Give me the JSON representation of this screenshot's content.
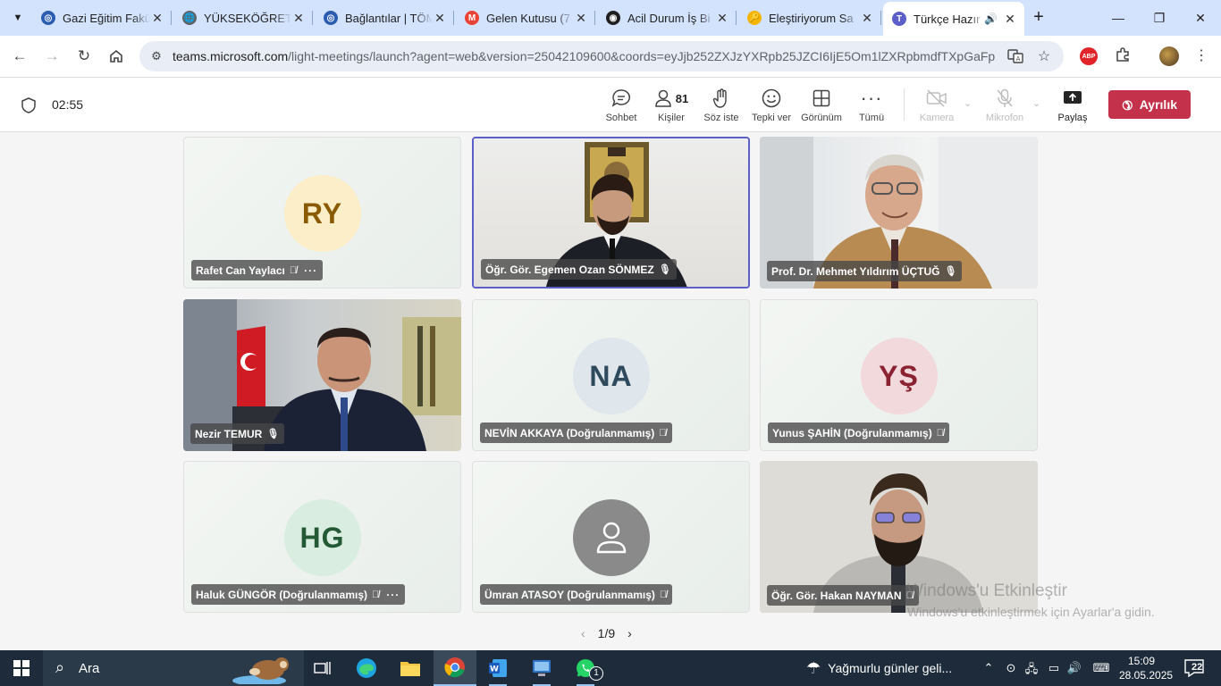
{
  "browser": {
    "tabs": [
      {
        "title": "Gazi Eğitim Fakü",
        "fav_color": "#2a5db0",
        "fav_glyph": "◎"
      },
      {
        "title": "YÜKSEKÖĞRETİM",
        "fav_color": "#5f6368",
        "fav_glyph": "🌐"
      },
      {
        "title": "Bağlantılar | TÖM",
        "fav_color": "#2a5db0",
        "fav_glyph": "◎"
      },
      {
        "title": "Gelen Kutusu (7",
        "fav_color": "#ea4335",
        "fav_glyph": "M"
      },
      {
        "title": "Acil Durum İş Bi",
        "fav_color": "#1f1f1f",
        "fav_glyph": "◉"
      },
      {
        "title": "Eleştiriyorum Sa",
        "fav_color": "#f4b400",
        "fav_glyph": "🔑"
      },
      {
        "title": "Türkçe Hazır",
        "fav_color": "#5b5fc7",
        "fav_glyph": "T"
      }
    ],
    "url_host": "teams.microsoft.com",
    "url_path": "/light-meetings/launch?agent=web&version=25042109600&coords=eyJjb252ZXJzYXRpb25JZCI6IjE5Om1lZXRpbmdfTXpGaFp...",
    "abp_label": "ABP"
  },
  "meeting": {
    "timer": "02:55",
    "controls": {
      "chat": "Sohbet",
      "people": "Kişiler",
      "people_count": "81",
      "raise_hand": "Söz iste",
      "react": "Tepki ver",
      "view": "Görünüm",
      "more": "Tümü",
      "camera": "Kamera",
      "mic": "Mikrofon",
      "share": "Paylaş",
      "leave": "Ayrılık"
    },
    "participants": [
      {
        "name": "Rafet Can Yaylacı",
        "initials": "RY",
        "avatar_bg": "#fbeec8",
        "avatar_fg": "#8a5a00",
        "has_more": true
      },
      {
        "name": "Öğr. Gör. Egemen Ozan SÖNMEZ",
        "video": "office"
      },
      {
        "name": "Prof. Dr. Mehmet Yıldırım ÜÇTUĞ",
        "video": "window"
      },
      {
        "name": "Nezir TEMUR",
        "video": "flag"
      },
      {
        "name": "NEVİN AKKAYA (Doğrulanmamış)",
        "initials": "NA",
        "avatar_bg": "#dfe6ec",
        "avatar_fg": "#2e4a5c"
      },
      {
        "name": "Yunus ŞAHİN (Doğrulanmamış)",
        "initials": "YŞ",
        "avatar_bg": "#f2d9dc",
        "avatar_fg": "#8a2232"
      },
      {
        "name": "Haluk GÜNGÖR (Doğrulanmamış)",
        "initials": "HG",
        "avatar_bg": "#d9ede0",
        "avatar_fg": "#235a35",
        "has_more": true
      },
      {
        "name": "Ümran ATASOY (Doğrulanmamış)",
        "avatar_bg": "#8a8a8a"
      },
      {
        "name": "Öğr. Gör. Hakan NAYMAN",
        "video": "lab"
      }
    ],
    "pager": "1/9"
  },
  "watermark": {
    "line1": "Windows'u Etkinleştir",
    "line2": "Windows'u etkinleştirmek için Ayarlar'a gidin."
  },
  "taskbar": {
    "search_placeholder": "Ara",
    "weather": "Yağmurlu günler geli...",
    "time": "15:09",
    "date": "28.05.2025",
    "notifications": "22",
    "whatsapp_badge": "1"
  }
}
